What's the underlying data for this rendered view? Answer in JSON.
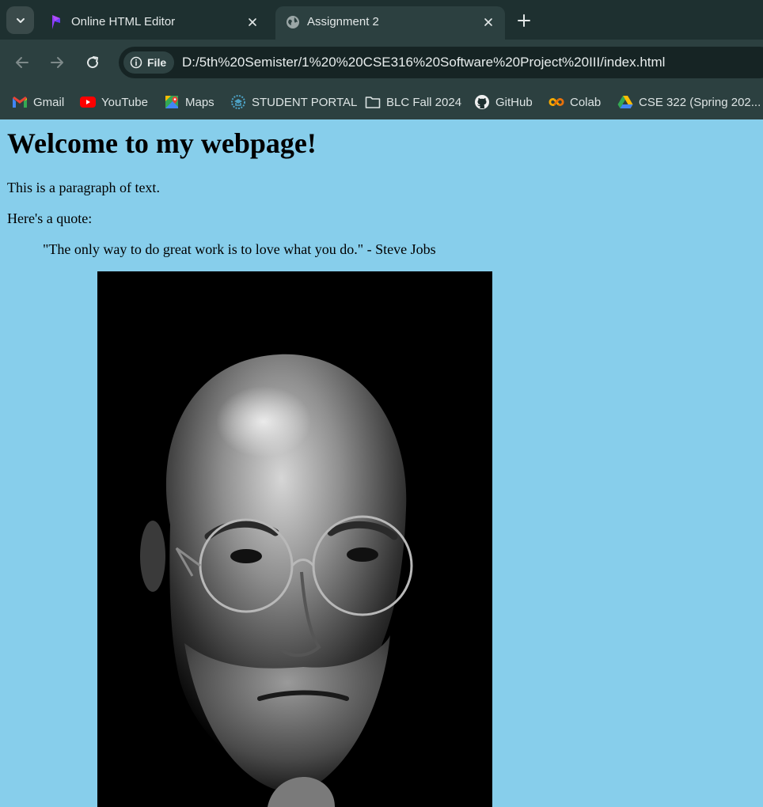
{
  "tabs": [
    {
      "title": "Online HTML Editor",
      "favicon": "playcode-logo-icon",
      "active": false
    },
    {
      "title": "Assignment 2",
      "favicon": "globe-icon",
      "active": true
    }
  ],
  "toolbar": {
    "chip_label": "File",
    "url": "D:/5th%20Semister/1%20%20CSE316%20Software%20Project%20III/index.html"
  },
  "bookmarks": [
    {
      "label": "Gmail",
      "icon": "gmail-icon"
    },
    {
      "label": "YouTube",
      "icon": "youtube-icon"
    },
    {
      "label": "Maps",
      "icon": "maps-icon"
    },
    {
      "label": "STUDENT PORTAL",
      "icon": "student-portal-icon"
    },
    {
      "label": "BLC Fall 2024",
      "icon": "folder-icon"
    },
    {
      "label": "GitHub",
      "icon": "github-icon"
    },
    {
      "label": "Colab",
      "icon": "colab-icon"
    },
    {
      "label": "CSE 322 (Spring 202...",
      "icon": "google-drive-icon"
    }
  ],
  "page": {
    "heading": "Welcome to my webpage!",
    "paragraph": "This is a paragraph of text.",
    "quote_intro": "Here's a quote:",
    "quote": "\"The only way to do great work is to love what you do.\" - Steve Jobs",
    "background_color": "#87CEEB"
  },
  "colors": {
    "tab_strip": "#1e3030",
    "toolbar": "#2c4040",
    "omnibox": "#162424"
  }
}
